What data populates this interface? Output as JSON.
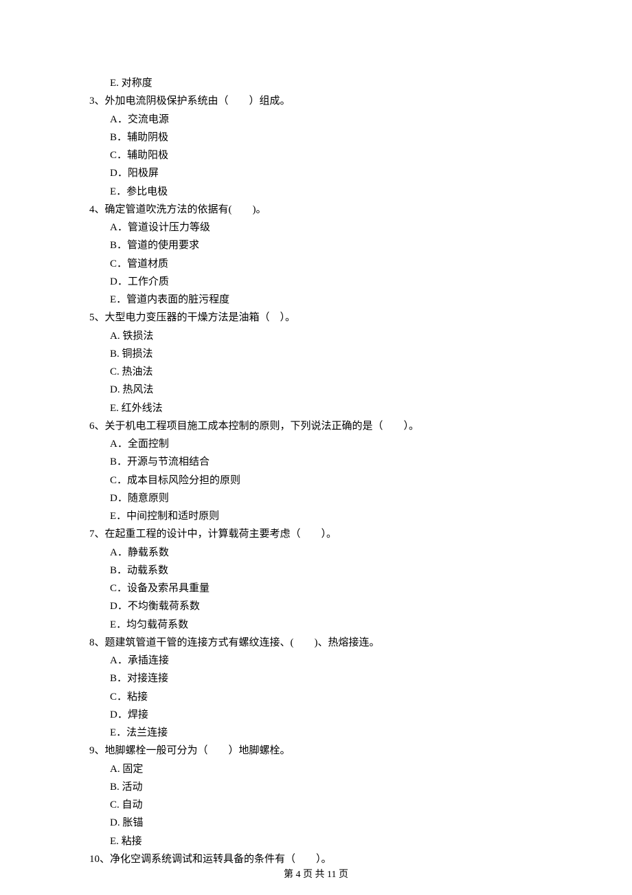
{
  "leading_option": "E. 对称度",
  "questions": [
    {
      "num": "3、",
      "stem": "外加电流阴极保护系统由（　　）组成。",
      "options": [
        "A．交流电源",
        "B．辅助阴极",
        "C．辅助阳极",
        "D．阳极屏",
        "E．参比电极"
      ]
    },
    {
      "num": "4、",
      "stem": "确定管道吹洗方法的依据有(　　)。",
      "options": [
        "A．管道设计压力等级",
        "B．管道的使用要求",
        "C．管道材质",
        "D．工作介质",
        "E．管道内表面的脏污程度"
      ]
    },
    {
      "num": "5、",
      "stem": "大型电力变压器的干燥方法是油箱（　）。",
      "options": [
        "A. 铁损法",
        "B. 铜损法",
        "C. 热油法",
        "D. 热风法",
        "E. 红外线法"
      ]
    },
    {
      "num": "6、",
      "stem": "关于机电工程项目施工成本控制的原则，下列说法正确的是（　　）。",
      "options": [
        "A．全面控制",
        "B．开源与节流相结合",
        "C．成本目标风险分担的原则",
        "D．随意原则",
        "E．中间控制和适时原则"
      ]
    },
    {
      "num": "7、",
      "stem": "在起重工程的设计中，计算载荷主要考虑（　　）。",
      "options": [
        "A．静载系数",
        "B．动载系数",
        "C．设备及索吊具重量",
        "D．不均衡载荷系数",
        "E．均匀载荷系数"
      ]
    },
    {
      "num": "8、",
      "stem": "题建筑管道干管的连接方式有螺纹连接、(　　)、热熔接连。",
      "options": [
        "A．承插连接",
        "B．对接连接",
        "C．粘接",
        "D．焊接",
        "E．法兰连接"
      ]
    },
    {
      "num": "9、",
      "stem": "地脚螺栓一般可分为（　　）地脚螺栓。",
      "options": [
        "A. 固定",
        "B. 活动",
        "C. 自动",
        "D. 胀锚",
        "E. 粘接"
      ]
    },
    {
      "num": "10、",
      "stem": "净化空调系统调试和运转具备的条件有（　　）。",
      "options": []
    }
  ],
  "footer": "第 4 页 共 11 页"
}
